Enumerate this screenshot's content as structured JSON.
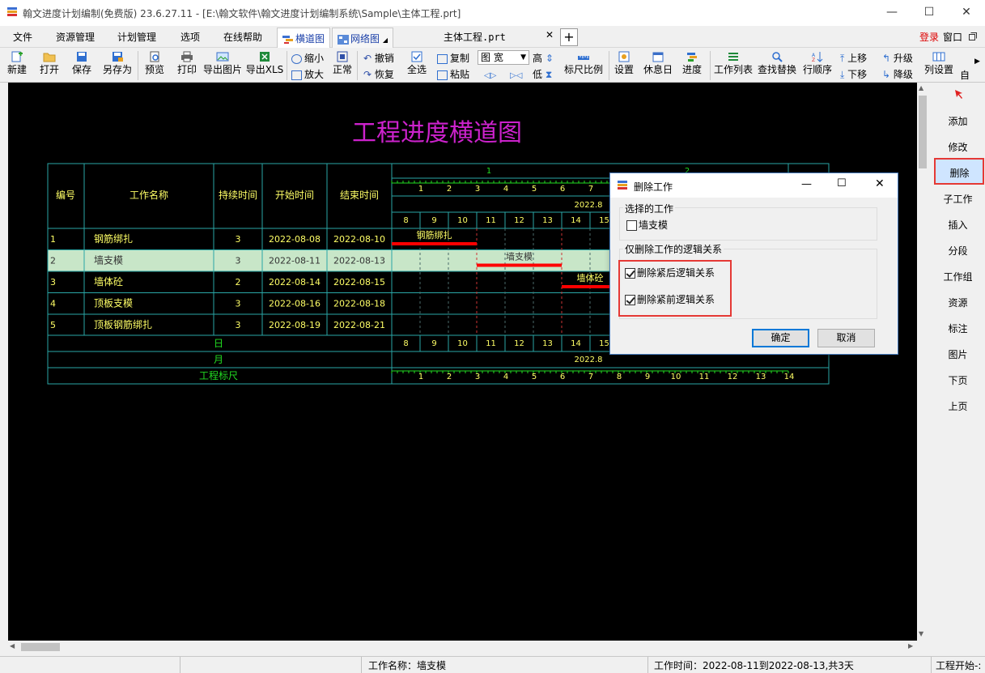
{
  "window": {
    "title": "翰文进度计划编制(免费版) 23.6.27.11 - [E:\\翰文软件\\翰文进度计划编制系统\\Sample\\主体工程.prt]",
    "min": "—",
    "max": "☐",
    "close": "✕"
  },
  "menu": {
    "items": [
      "文件",
      "资源管理",
      "计划管理",
      "选项",
      "在线帮助"
    ],
    "tabs": [
      {
        "label": "横道图"
      },
      {
        "label": "网络图"
      }
    ],
    "doc_tab": "主体工程.prt",
    "doc_close": "✕",
    "add": "+",
    "login": "登录",
    "window": "窗口"
  },
  "toolbar": {
    "new": "新建",
    "open": "打开",
    "save": "保存",
    "save_as": "另存为",
    "preview": "预览",
    "print": "打印",
    "export_image": "导出图片",
    "export_xls": "导出XLS",
    "zoom_out": "缩小",
    "zoom_in": "放大",
    "normal": "正常",
    "undo": "撤销",
    "redo": "恢复",
    "select_all": "全选",
    "copy": "复制",
    "paste": "粘贴",
    "view_select": "图 宽",
    "high": "高",
    "low": "低",
    "ruler_ratio": "标尺比例",
    "settings": "设置",
    "holiday": "休息日",
    "progress": "进度",
    "work_list": "工作列表",
    "find_replace": "查找替换",
    "row_order": "行顺序",
    "move_up": "上移",
    "move_down": "下移",
    "upgrade": "升级",
    "downgrade": "降级",
    "column_settings": "列设置",
    "auto": "自"
  },
  "gantt": {
    "title": "工程进度横道图",
    "headers": {
      "no": "编号",
      "name": "工作名称",
      "duration": "持续时间",
      "start": "开始时间",
      "end": "结束时间"
    },
    "week_labels": [
      "1",
      "2"
    ],
    "ruler_labels": [
      "1",
      "2",
      "3",
      "4",
      "5",
      "6",
      "7",
      "8",
      "9",
      "10",
      "11",
      "12",
      "13",
      "14"
    ],
    "month_label": "2022.8",
    "day_labels": [
      "8",
      "9",
      "10",
      "11",
      "12",
      "13",
      "14",
      "15"
    ],
    "rows": [
      {
        "no": "1",
        "name": "钢筋绑扎",
        "duration": "3",
        "start": "2022-08-08",
        "end": "2022-08-10",
        "bar_label": "钢筋绑扎"
      },
      {
        "no": "2",
        "name": "墙支模",
        "duration": "3",
        "start": "2022-08-11",
        "end": "2022-08-13",
        "bar_label": "墙支模"
      },
      {
        "no": "3",
        "name": "墙体砼",
        "duration": "2",
        "start": "2022-08-14",
        "end": "2022-08-15",
        "bar_label": "墙体砼"
      },
      {
        "no": "4",
        "name": "顶板支模",
        "duration": "3",
        "start": "2022-08-16",
        "end": "2022-08-18",
        "bar_label": ""
      },
      {
        "no": "5",
        "name": "顶板钢筋绑扎",
        "duration": "3",
        "start": "2022-08-19",
        "end": "2022-08-21",
        "bar_label": ""
      }
    ],
    "footer": {
      "day": "日",
      "month": "月",
      "ruler": "工程标尺"
    }
  },
  "side_panel": {
    "items": [
      "添加",
      "修改",
      "删除",
      "子工作",
      "插入",
      "分段",
      "工作组",
      "资源",
      "标注",
      "图片",
      "下页",
      "上页"
    ]
  },
  "dialog": {
    "title": "删除工作",
    "group1": "选择的工作",
    "selected_work": "墙支模",
    "group2": "仅删除工作的逻辑关系",
    "opt_after": "删除紧后逻辑关系",
    "opt_before": "删除紧前逻辑关系",
    "ok": "确定",
    "cancel": "取消"
  },
  "status": {
    "work_name": "工作名称：墙支模",
    "work_time": "工作时间：2022-08-11到2022-08-13,共3天",
    "work_start": "工程开始-:"
  },
  "colors": {
    "accent": "#ff0000",
    "title": "#cc22cc",
    "grid": "#2aa6a6",
    "bar": "#ff0000"
  }
}
